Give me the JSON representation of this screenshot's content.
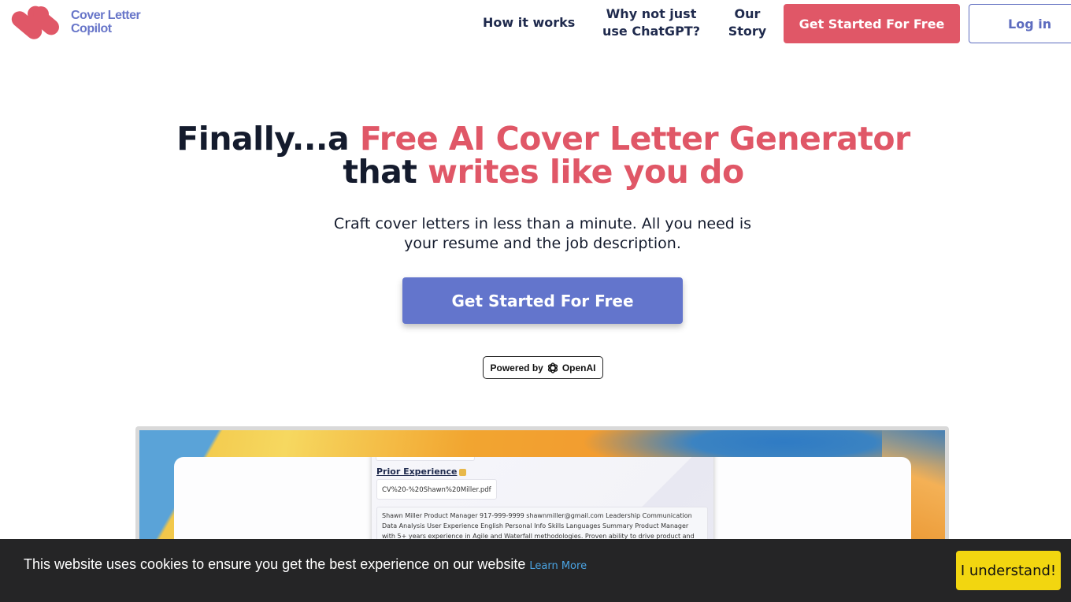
{
  "header": {
    "logo_text_line1": "Cover Letter",
    "logo_text_line2": "Copilot",
    "nav": {
      "how_it_works": "How it works",
      "why_not_chatgpt": "Why not just use ChatGPT?",
      "our_story": "Our Story"
    },
    "get_started_label": "Get Started For Free",
    "login_label": "Log in"
  },
  "hero": {
    "title_part1": "Finally...a ",
    "title_accent1": "Free AI Cover Letter Generator",
    "title_part2": "that ",
    "title_accent2": "writes like you do",
    "subtitle": "Craft cover letters in less than a minute. All you need is your resume and the job description.",
    "cta_label": "Get Started For Free",
    "powered_by_label": "Powered by",
    "powered_by_brand": "OpenAI"
  },
  "preview": {
    "section_title": "Prior Experience",
    "file_name": "CV%20-%20Shawn%20Miller.pdf",
    "resume_text": "Shawn Miller Product Manager 917-999-9999 shawnmiller@gmail.com Leadership Communication Data Analysis User Experience English Personal Info Skills Languages Summary Product Manager with 5+ years experience in Agile and Waterfall methodologies. Proven ability to drive product and"
  },
  "cookie": {
    "message": "This website uses cookies to ensure you get the best experience on our website",
    "learn_more": "Learn More",
    "accept_label": "I understand!"
  },
  "colors": {
    "brand_red": "#e05767",
    "brand_blue": "#6375cc",
    "cookie_button": "#f2d610",
    "cookie_bg": "#252526"
  }
}
